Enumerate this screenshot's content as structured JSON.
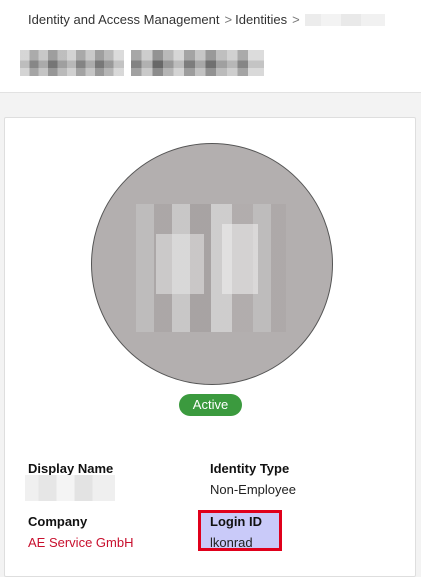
{
  "breadcrumb": {
    "items": [
      "Identity and Access Management",
      "Identities"
    ],
    "separator": ">"
  },
  "profile": {
    "status": "Active",
    "fields": {
      "display_name_label": "Display Name",
      "identity_type_label": "Identity Type",
      "identity_type_value": "Non-Employee",
      "company_label": "Company",
      "company_value": "AE Service GmbH",
      "login_id_label": "Login ID",
      "login_id_value": "lkonrad"
    }
  },
  "colors": {
    "status_badge": "#3b9a3e",
    "company_link": "#c8102e",
    "highlight_fill": "#c9caf9",
    "highlight_border": "#e0001b"
  }
}
